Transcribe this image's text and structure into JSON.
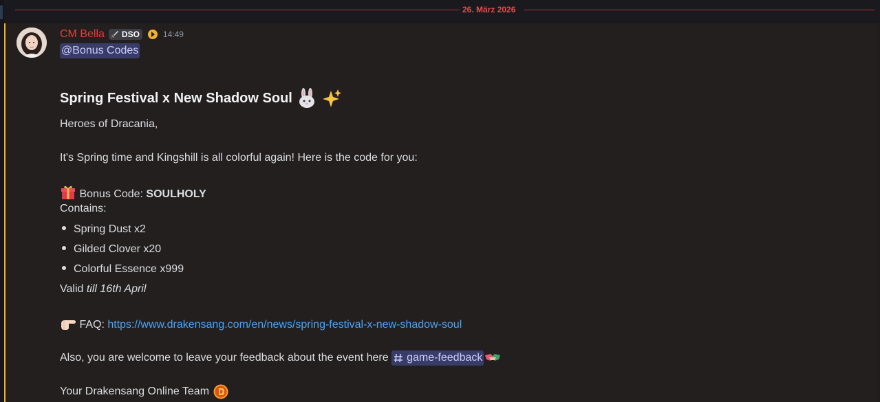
{
  "date_divider": "26. März 2026",
  "message": {
    "author": "CM Bella",
    "server_tag": "DSO",
    "timestamp": "14:49",
    "role_mention": "@Bonus Codes",
    "heading": "Spring Festival x New Shadow Soul",
    "greeting": "Heroes of Dracania,",
    "intro": "It's Spring time and Kingshill is all colorful again! Here is the code for you:",
    "bonus_label": "Bonus Code: ",
    "bonus_code": "SOULHOLY",
    "contains_label": "Contains:",
    "items": [
      "Spring Dust x2",
      "Gilded Clover x20",
      "Colorful Essence x999"
    ],
    "valid_prefix": "Valid ",
    "valid_date": "till 16th April",
    "faq_label": "FAQ: ",
    "faq_url": "https://www.drakensang.com/en/news/spring-festival-x-new-shadow-soul",
    "feedback_text": "Also, you are welcome to leave your feedback about the event here ",
    "channel_name": "game-feedback",
    "signature": "Your Drakensang Online Team"
  },
  "colors": {
    "author": "#e0413a",
    "mention_bar": "#f0b232",
    "mention_bg": "#3a3c68",
    "mention_text": "#c9cdfb",
    "link": "#4ea3f5",
    "divider": "#f0474a"
  },
  "icons": [
    "sword-icon",
    "boost-icon",
    "rabbit-emoji",
    "sparkles-emoji",
    "gift-emoji",
    "pointing-hand-emoji",
    "channel-hash-icon",
    "handshake-emoji",
    "drakensang-logo-icon"
  ]
}
